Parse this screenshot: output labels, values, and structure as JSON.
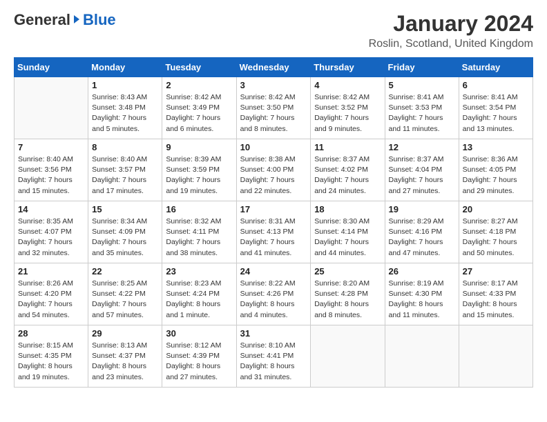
{
  "header": {
    "logo_general": "General",
    "logo_blue": "Blue",
    "month_title": "January 2024",
    "location": "Roslin, Scotland, United Kingdom"
  },
  "days_of_week": [
    "Sunday",
    "Monday",
    "Tuesday",
    "Wednesday",
    "Thursday",
    "Friday",
    "Saturday"
  ],
  "weeks": [
    [
      {
        "day": "",
        "sunrise": "",
        "sunset": "",
        "daylight": ""
      },
      {
        "day": "1",
        "sunrise": "Sunrise: 8:43 AM",
        "sunset": "Sunset: 3:48 PM",
        "daylight": "Daylight: 7 hours and 5 minutes."
      },
      {
        "day": "2",
        "sunrise": "Sunrise: 8:42 AM",
        "sunset": "Sunset: 3:49 PM",
        "daylight": "Daylight: 7 hours and 6 minutes."
      },
      {
        "day": "3",
        "sunrise": "Sunrise: 8:42 AM",
        "sunset": "Sunset: 3:50 PM",
        "daylight": "Daylight: 7 hours and 8 minutes."
      },
      {
        "day": "4",
        "sunrise": "Sunrise: 8:42 AM",
        "sunset": "Sunset: 3:52 PM",
        "daylight": "Daylight: 7 hours and 9 minutes."
      },
      {
        "day": "5",
        "sunrise": "Sunrise: 8:41 AM",
        "sunset": "Sunset: 3:53 PM",
        "daylight": "Daylight: 7 hours and 11 minutes."
      },
      {
        "day": "6",
        "sunrise": "Sunrise: 8:41 AM",
        "sunset": "Sunset: 3:54 PM",
        "daylight": "Daylight: 7 hours and 13 minutes."
      }
    ],
    [
      {
        "day": "7",
        "sunrise": "Sunrise: 8:40 AM",
        "sunset": "Sunset: 3:56 PM",
        "daylight": "Daylight: 7 hours and 15 minutes."
      },
      {
        "day": "8",
        "sunrise": "Sunrise: 8:40 AM",
        "sunset": "Sunset: 3:57 PM",
        "daylight": "Daylight: 7 hours and 17 minutes."
      },
      {
        "day": "9",
        "sunrise": "Sunrise: 8:39 AM",
        "sunset": "Sunset: 3:59 PM",
        "daylight": "Daylight: 7 hours and 19 minutes."
      },
      {
        "day": "10",
        "sunrise": "Sunrise: 8:38 AM",
        "sunset": "Sunset: 4:00 PM",
        "daylight": "Daylight: 7 hours and 22 minutes."
      },
      {
        "day": "11",
        "sunrise": "Sunrise: 8:37 AM",
        "sunset": "Sunset: 4:02 PM",
        "daylight": "Daylight: 7 hours and 24 minutes."
      },
      {
        "day": "12",
        "sunrise": "Sunrise: 8:37 AM",
        "sunset": "Sunset: 4:04 PM",
        "daylight": "Daylight: 7 hours and 27 minutes."
      },
      {
        "day": "13",
        "sunrise": "Sunrise: 8:36 AM",
        "sunset": "Sunset: 4:05 PM",
        "daylight": "Daylight: 7 hours and 29 minutes."
      }
    ],
    [
      {
        "day": "14",
        "sunrise": "Sunrise: 8:35 AM",
        "sunset": "Sunset: 4:07 PM",
        "daylight": "Daylight: 7 hours and 32 minutes."
      },
      {
        "day": "15",
        "sunrise": "Sunrise: 8:34 AM",
        "sunset": "Sunset: 4:09 PM",
        "daylight": "Daylight: 7 hours and 35 minutes."
      },
      {
        "day": "16",
        "sunrise": "Sunrise: 8:32 AM",
        "sunset": "Sunset: 4:11 PM",
        "daylight": "Daylight: 7 hours and 38 minutes."
      },
      {
        "day": "17",
        "sunrise": "Sunrise: 8:31 AM",
        "sunset": "Sunset: 4:13 PM",
        "daylight": "Daylight: 7 hours and 41 minutes."
      },
      {
        "day": "18",
        "sunrise": "Sunrise: 8:30 AM",
        "sunset": "Sunset: 4:14 PM",
        "daylight": "Daylight: 7 hours and 44 minutes."
      },
      {
        "day": "19",
        "sunrise": "Sunrise: 8:29 AM",
        "sunset": "Sunset: 4:16 PM",
        "daylight": "Daylight: 7 hours and 47 minutes."
      },
      {
        "day": "20",
        "sunrise": "Sunrise: 8:27 AM",
        "sunset": "Sunset: 4:18 PM",
        "daylight": "Daylight: 7 hours and 50 minutes."
      }
    ],
    [
      {
        "day": "21",
        "sunrise": "Sunrise: 8:26 AM",
        "sunset": "Sunset: 4:20 PM",
        "daylight": "Daylight: 7 hours and 54 minutes."
      },
      {
        "day": "22",
        "sunrise": "Sunrise: 8:25 AM",
        "sunset": "Sunset: 4:22 PM",
        "daylight": "Daylight: 7 hours and 57 minutes."
      },
      {
        "day": "23",
        "sunrise": "Sunrise: 8:23 AM",
        "sunset": "Sunset: 4:24 PM",
        "daylight": "Daylight: 8 hours and 1 minute."
      },
      {
        "day": "24",
        "sunrise": "Sunrise: 8:22 AM",
        "sunset": "Sunset: 4:26 PM",
        "daylight": "Daylight: 8 hours and 4 minutes."
      },
      {
        "day": "25",
        "sunrise": "Sunrise: 8:20 AM",
        "sunset": "Sunset: 4:28 PM",
        "daylight": "Daylight: 8 hours and 8 minutes."
      },
      {
        "day": "26",
        "sunrise": "Sunrise: 8:19 AM",
        "sunset": "Sunset: 4:30 PM",
        "daylight": "Daylight: 8 hours and 11 minutes."
      },
      {
        "day": "27",
        "sunrise": "Sunrise: 8:17 AM",
        "sunset": "Sunset: 4:33 PM",
        "daylight": "Daylight: 8 hours and 15 minutes."
      }
    ],
    [
      {
        "day": "28",
        "sunrise": "Sunrise: 8:15 AM",
        "sunset": "Sunset: 4:35 PM",
        "daylight": "Daylight: 8 hours and 19 minutes."
      },
      {
        "day": "29",
        "sunrise": "Sunrise: 8:13 AM",
        "sunset": "Sunset: 4:37 PM",
        "daylight": "Daylight: 8 hours and 23 minutes."
      },
      {
        "day": "30",
        "sunrise": "Sunrise: 8:12 AM",
        "sunset": "Sunset: 4:39 PM",
        "daylight": "Daylight: 8 hours and 27 minutes."
      },
      {
        "day": "31",
        "sunrise": "Sunrise: 8:10 AM",
        "sunset": "Sunset: 4:41 PM",
        "daylight": "Daylight: 8 hours and 31 minutes."
      },
      {
        "day": "",
        "sunrise": "",
        "sunset": "",
        "daylight": ""
      },
      {
        "day": "",
        "sunrise": "",
        "sunset": "",
        "daylight": ""
      },
      {
        "day": "",
        "sunrise": "",
        "sunset": "",
        "daylight": ""
      }
    ]
  ]
}
